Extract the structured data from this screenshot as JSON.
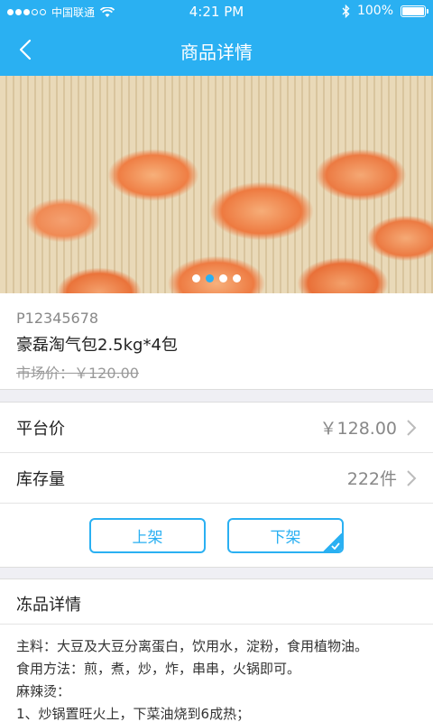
{
  "status_bar": {
    "carrier": "中国联通",
    "time": "4:21 PM",
    "battery": "100%",
    "signal_bars": 3
  },
  "nav": {
    "title": "商品详情",
    "back_icon": "chevron-left-icon"
  },
  "gallery": {
    "image_count": 4,
    "active_index": 1
  },
  "product": {
    "code": "P12345678",
    "name": "豪磊淘气包2.5kg*4包",
    "market_price": "市场价：￥120.00"
  },
  "rows": [
    {
      "label": "平台价",
      "value": "￥128.00"
    },
    {
      "label": "库存量",
      "value": "222件"
    }
  ],
  "actions": {
    "on_shelf": "上架",
    "off_shelf": "下架",
    "selected": "off_shelf"
  },
  "details": {
    "title": "冻品详情",
    "lines": [
      "主料：大豆及大豆分离蛋白，饮用水，淀粉，食用植物油。",
      "食用方法：煎，煮，炒，炸，串串，火锅即可。",
      "麻辣烫：",
      "1、炒锅置旺火上，下菜油烧到6成热；"
    ]
  },
  "colors": {
    "accent": "#2ab0f2",
    "background": "#efeff4"
  }
}
